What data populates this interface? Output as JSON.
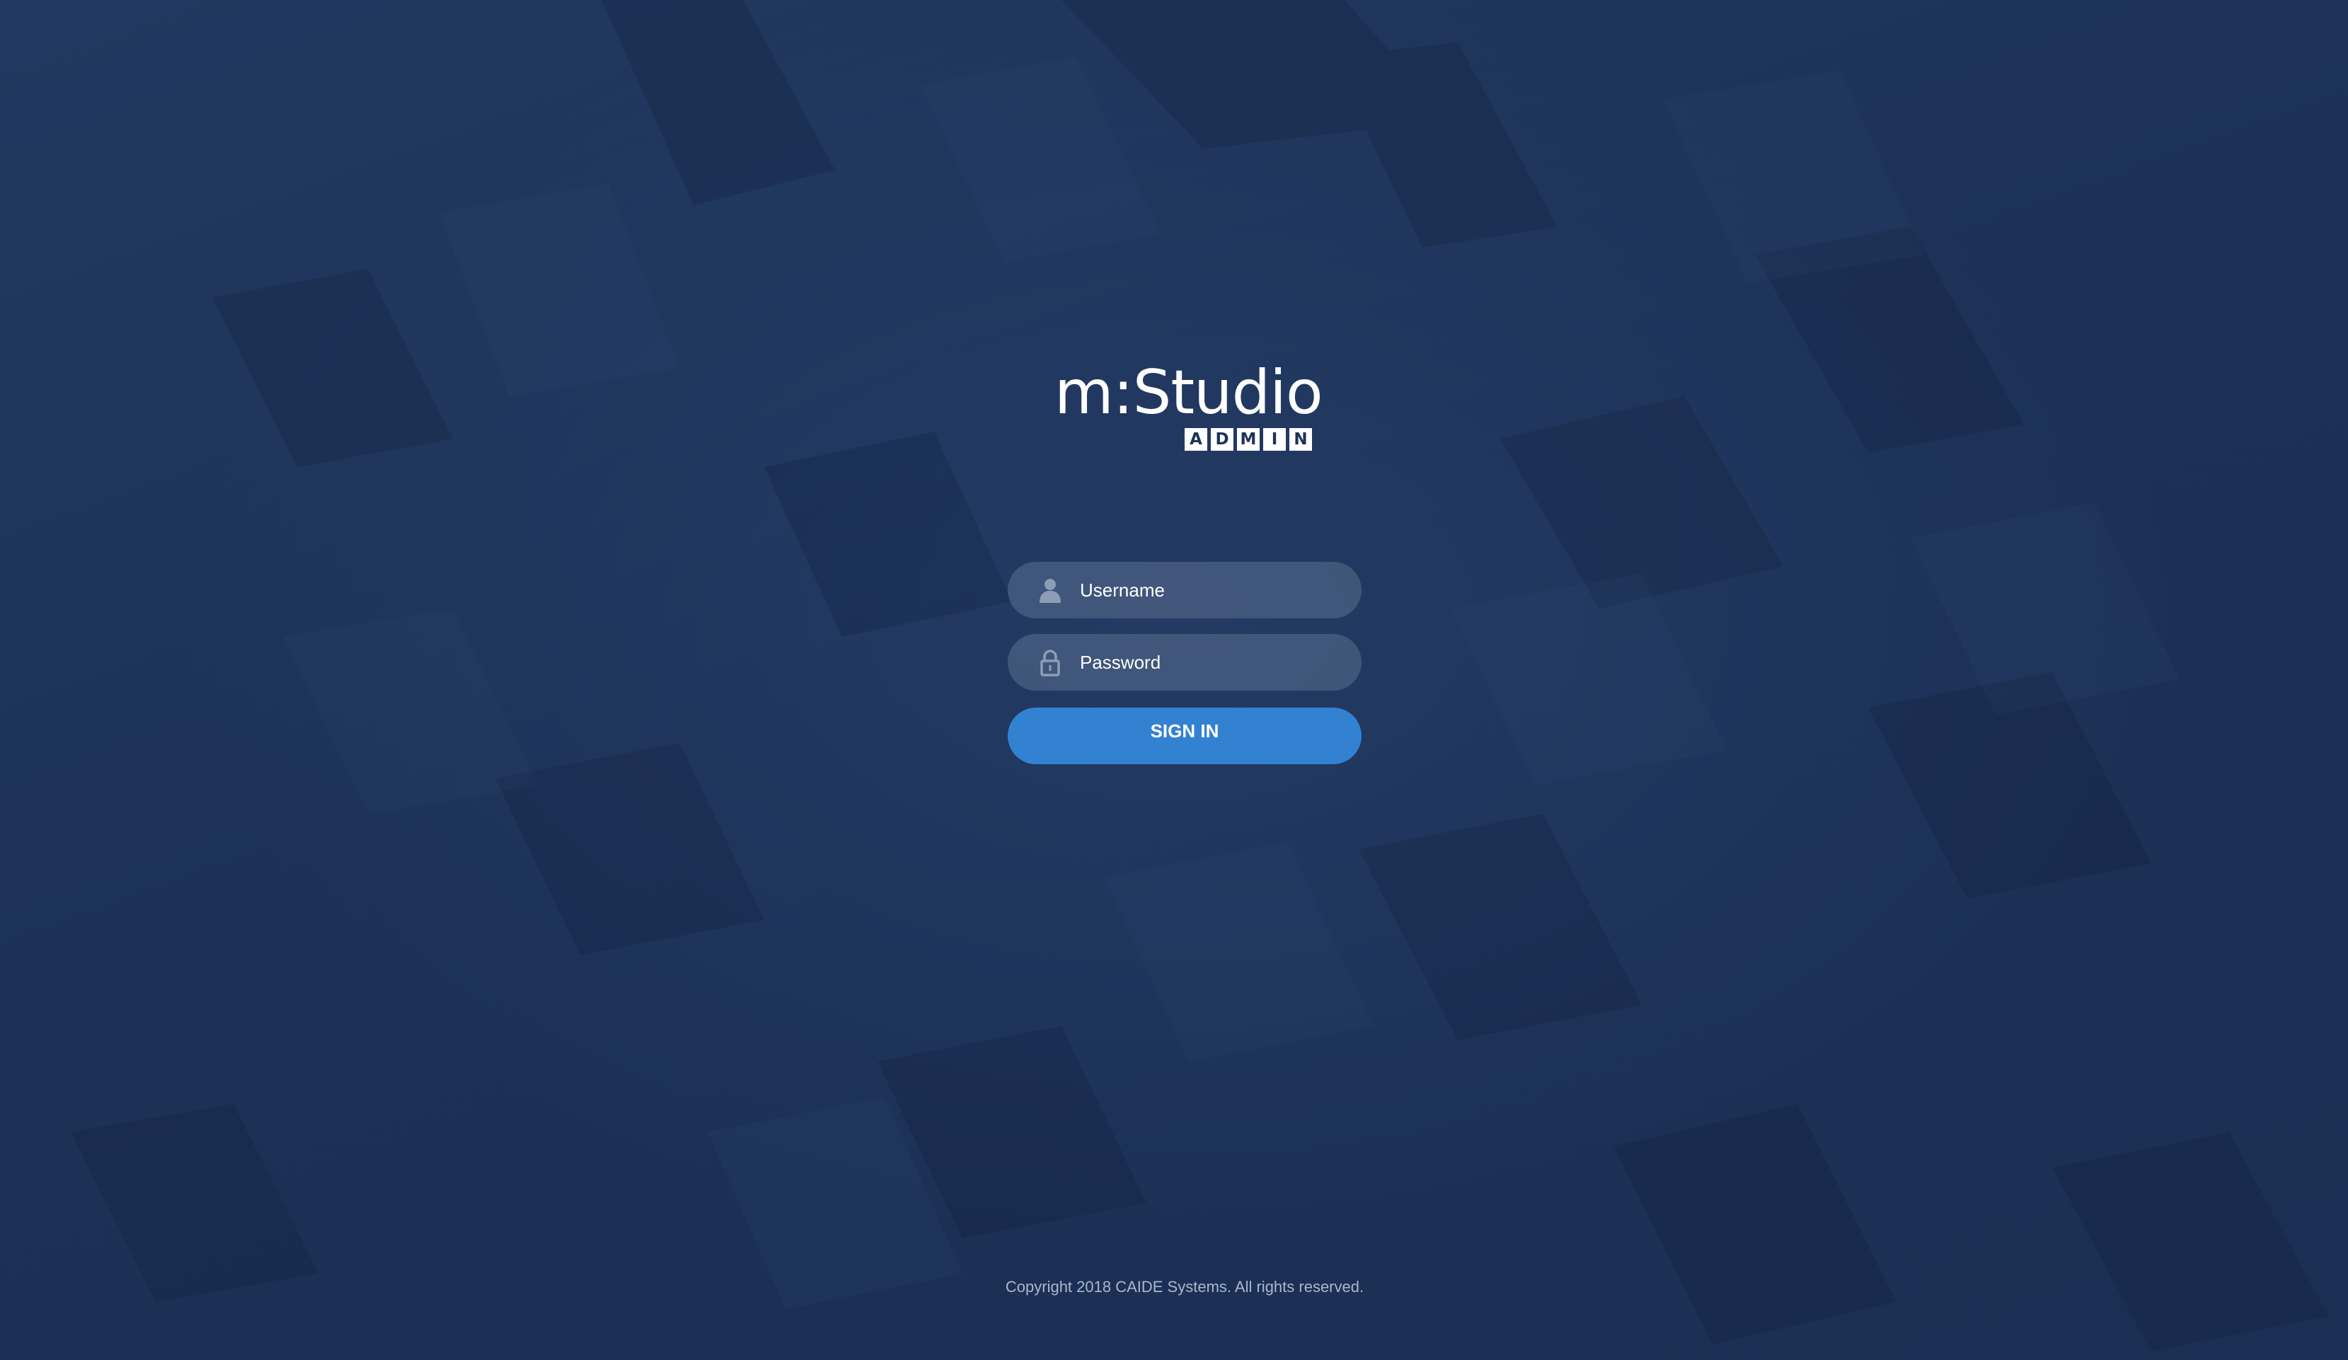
{
  "app": {
    "logo_text": "m:Studio",
    "logo_badge": [
      "A",
      "D",
      "M",
      "I",
      "N"
    ]
  },
  "login": {
    "username_placeholder": "Username",
    "username_value": "",
    "password_placeholder": "Password",
    "password_value": "",
    "signin_label": "SIGN IN"
  },
  "footer": {
    "copyright": "Copyright 2018 CAIDE Systems. All rights reserved."
  },
  "icons": {
    "username": "user-icon",
    "password": "lock-icon"
  },
  "colors": {
    "background": "#1e3258",
    "field": "#4a5f83",
    "button": "#3382d2",
    "text": "#ffffff",
    "footer_text": "#aab7cc"
  }
}
